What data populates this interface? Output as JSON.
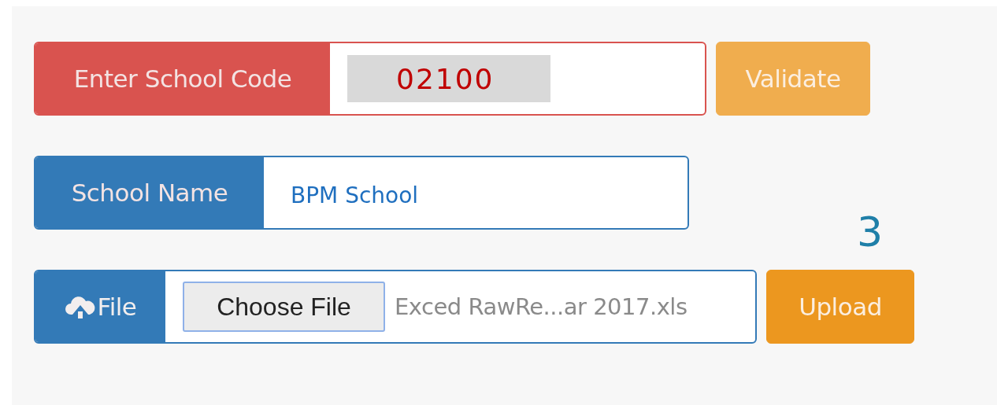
{
  "school_code": {
    "label": "Enter School Code",
    "value": "02100"
  },
  "validate_button": {
    "label": "Validate"
  },
  "school_name": {
    "label": "School Name",
    "value": "BPM School"
  },
  "step_number": "3",
  "file": {
    "label": "File",
    "choose_button": "Choose File",
    "filename": "Exced RawRe...ar 2017.xls"
  },
  "upload_button": {
    "label": "Upload"
  }
}
